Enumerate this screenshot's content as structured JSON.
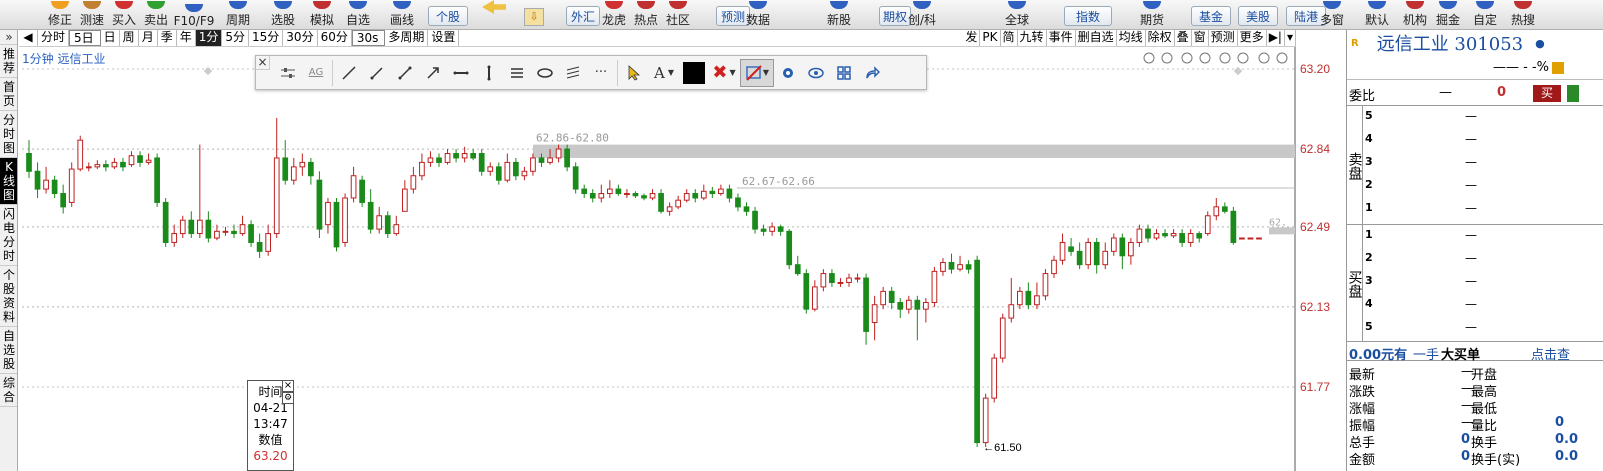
{
  "toolbar": {
    "items": [
      "修正",
      "测速",
      "买入",
      "卖出",
      "F10/F9",
      "周期",
      "选股",
      "模拟",
      "自选",
      "画线",
      "个股",
      "外汇",
      "龙虎",
      "热点",
      "社区",
      "预测",
      "数据",
      "新股",
      "期权",
      "创/科",
      "全球",
      "指数",
      "期货",
      "基金",
      "美股",
      "陆港",
      "多窗",
      "默认",
      "机构",
      "掘金",
      "自定",
      "热搜"
    ],
    "icon_colors": [
      "#f0a020",
      "#c08030",
      "#d03030",
      "#30a030",
      "#3060c0",
      "#3060c0",
      "#3060c0",
      "#c03030",
      "#3060c0",
      "#3060c0",
      "#e8b020",
      "#5080c0",
      "#d03030",
      "#c03030",
      "#c03030",
      "#3060c0",
      "#3060c0",
      "#3060c0",
      "#c03030",
      "#3060c0",
      "#3060c0",
      "#3060c0",
      "#3060c0",
      "#3060c0",
      "#3060c0",
      "#3060c0",
      "#3060c0",
      "#3060c0",
      "#c03030",
      "#3060c0",
      "#3060c0",
      "#c03030"
    ]
  },
  "leftnav": [
    "推荐",
    "首页",
    "分时图",
    "K线图",
    "闪电分时",
    "个股资料",
    "自选股",
    "综合"
  ],
  "periods": [
    "分时",
    "5日",
    "日",
    "周",
    "月",
    "季",
    "年",
    "1分",
    "5分",
    "15分",
    "30分",
    "60分"
  ],
  "period_select": "30s",
  "period_multi": "多周期",
  "period_settings": "设置",
  "active_period": "1分",
  "right_actions": [
    "发",
    "PK",
    "简",
    "九转",
    "事件",
    "删自选",
    "均线",
    "除权",
    "叠",
    "窗",
    "预测",
    "更多"
  ],
  "stock_label": "1分钟  远信工业",
  "y_ticks": [
    "63.20",
    "62.84",
    "62.49",
    "62.13",
    "61.77"
  ],
  "chart_data": {
    "type": "candlestick",
    "title": "1分钟 远信工业",
    "ylim": [
      61.45,
      63.25
    ],
    "y_ticks": [
      63.2,
      62.84,
      62.49,
      62.13,
      61.77
    ],
    "price_bands": [
      "62.86-62.80",
      "62.67-62.66"
    ],
    "low_marker": "61.50",
    "right_edge_label": "62.",
    "series": [
      {
        "o": 62.82,
        "c": 62.74,
        "h": 62.88,
        "l": 62.71
      },
      {
        "o": 62.74,
        "c": 62.66,
        "h": 62.78,
        "l": 62.62
      },
      {
        "o": 62.66,
        "c": 62.7,
        "h": 62.76,
        "l": 62.64
      },
      {
        "o": 62.7,
        "c": 62.64,
        "h": 62.72,
        "l": 62.62
      },
      {
        "o": 62.64,
        "c": 62.58,
        "h": 62.68,
        "l": 62.55
      },
      {
        "o": 62.6,
        "c": 62.75,
        "h": 62.78,
        "l": 62.58
      },
      {
        "o": 62.75,
        "c": 62.88,
        "h": 62.9,
        "l": 62.74
      },
      {
        "o": 62.76,
        "c": 62.76,
        "h": 62.78,
        "l": 62.74
      },
      {
        "o": 62.76,
        "c": 62.77,
        "h": 62.79,
        "l": 62.75
      },
      {
        "o": 62.77,
        "c": 62.76,
        "h": 62.79,
        "l": 62.74
      },
      {
        "o": 62.76,
        "c": 62.78,
        "h": 62.8,
        "l": 62.75
      },
      {
        "o": 62.78,
        "c": 62.76,
        "h": 62.8,
        "l": 62.74
      },
      {
        "o": 62.77,
        "c": 62.81,
        "h": 62.83,
        "l": 62.76
      },
      {
        "o": 62.81,
        "c": 62.78,
        "h": 62.83,
        "l": 62.76
      },
      {
        "o": 62.78,
        "c": 62.79,
        "h": 62.82,
        "l": 62.77
      },
      {
        "o": 62.8,
        "c": 62.6,
        "h": 62.82,
        "l": 62.58
      },
      {
        "o": 62.6,
        "c": 62.42,
        "h": 62.62,
        "l": 62.4
      },
      {
        "o": 62.42,
        "c": 62.46,
        "h": 62.5,
        "l": 62.4
      },
      {
        "o": 62.46,
        "c": 62.52,
        "h": 62.54,
        "l": 62.44
      },
      {
        "o": 62.52,
        "c": 62.46,
        "h": 62.56,
        "l": 62.44
      },
      {
        "o": 62.46,
        "c": 62.52,
        "h": 62.86,
        "l": 62.44
      },
      {
        "o": 62.52,
        "c": 62.44,
        "h": 62.56,
        "l": 62.42
      },
      {
        "o": 62.44,
        "c": 62.47,
        "h": 62.5,
        "l": 62.43
      },
      {
        "o": 62.47,
        "c": 62.47,
        "h": 62.49,
        "l": 62.45
      },
      {
        "o": 62.47,
        "c": 62.46,
        "h": 62.5,
        "l": 62.44
      },
      {
        "o": 62.46,
        "c": 62.5,
        "h": 62.54,
        "l": 62.45
      },
      {
        "o": 62.5,
        "c": 62.42,
        "h": 62.52,
        "l": 62.4
      },
      {
        "o": 62.42,
        "c": 62.38,
        "h": 62.46,
        "l": 62.35
      },
      {
        "o": 62.38,
        "c": 62.46,
        "h": 62.5,
        "l": 62.36
      },
      {
        "o": 62.46,
        "c": 62.8,
        "h": 62.98,
        "l": 62.44
      },
      {
        "o": 62.8,
        "c": 62.7,
        "h": 62.88,
        "l": 62.68
      },
      {
        "o": 62.7,
        "c": 62.76,
        "h": 62.8,
        "l": 62.68
      },
      {
        "o": 62.76,
        "c": 62.78,
        "h": 62.82,
        "l": 62.72
      },
      {
        "o": 62.78,
        "c": 62.72,
        "h": 62.8,
        "l": 62.68
      },
      {
        "o": 62.7,
        "c": 62.48,
        "h": 62.74,
        "l": 62.44
      },
      {
        "o": 62.5,
        "c": 62.6,
        "h": 62.62,
        "l": 62.46
      },
      {
        "o": 62.6,
        "c": 62.4,
        "h": 62.62,
        "l": 62.38
      },
      {
        "o": 62.42,
        "c": 62.62,
        "h": 62.64,
        "l": 62.4
      },
      {
        "o": 62.62,
        "c": 62.72,
        "h": 62.76,
        "l": 62.6
      },
      {
        "o": 62.7,
        "c": 62.6,
        "h": 62.72,
        "l": 62.58
      },
      {
        "o": 62.6,
        "c": 62.48,
        "h": 62.66,
        "l": 62.46
      },
      {
        "o": 62.48,
        "c": 62.54,
        "h": 62.58,
        "l": 62.46
      },
      {
        "o": 62.54,
        "c": 62.46,
        "h": 62.56,
        "l": 62.44
      },
      {
        "o": 62.46,
        "c": 62.5,
        "h": 62.54,
        "l": 62.45
      },
      {
        "o": 62.56,
        "c": 62.66,
        "h": 62.7,
        "l": 62.56
      },
      {
        "o": 62.66,
        "c": 62.72,
        "h": 62.76,
        "l": 62.64
      },
      {
        "o": 62.72,
        "c": 62.78,
        "h": 62.82,
        "l": 62.7
      },
      {
        "o": 62.78,
        "c": 62.8,
        "h": 62.83,
        "l": 62.76
      },
      {
        "o": 62.8,
        "c": 62.78,
        "h": 62.82,
        "l": 62.76
      },
      {
        "o": 62.78,
        "c": 62.82,
        "h": 62.84,
        "l": 62.77
      },
      {
        "o": 62.82,
        "c": 62.8,
        "h": 62.84,
        "l": 62.78
      },
      {
        "o": 62.8,
        "c": 62.82,
        "h": 62.85,
        "l": 62.78
      },
      {
        "o": 62.82,
        "c": 62.8,
        "h": 62.84,
        "l": 62.79
      },
      {
        "o": 62.82,
        "c": 62.74,
        "h": 62.84,
        "l": 62.72
      },
      {
        "o": 62.74,
        "c": 62.76,
        "h": 62.78,
        "l": 62.72
      },
      {
        "o": 62.76,
        "c": 62.7,
        "h": 62.78,
        "l": 62.68
      },
      {
        "o": 62.7,
        "c": 62.78,
        "h": 62.82,
        "l": 62.69
      },
      {
        "o": 62.78,
        "c": 62.72,
        "h": 62.8,
        "l": 62.7
      },
      {
        "o": 62.72,
        "c": 62.74,
        "h": 62.76,
        "l": 62.7
      },
      {
        "o": 62.74,
        "c": 62.8,
        "h": 62.82,
        "l": 62.72
      },
      {
        "o": 62.8,
        "c": 62.78,
        "h": 62.82,
        "l": 62.76
      },
      {
        "o": 62.78,
        "c": 62.8,
        "h": 62.84,
        "l": 62.77
      },
      {
        "o": 62.8,
        "c": 62.84,
        "h": 62.86,
        "l": 62.78
      },
      {
        "o": 62.84,
        "c": 62.76,
        "h": 62.86,
        "l": 62.74
      },
      {
        "o": 62.76,
        "c": 62.66,
        "h": 62.78,
        "l": 62.64
      },
      {
        "o": 62.66,
        "c": 62.64,
        "h": 62.68,
        "l": 62.62
      },
      {
        "o": 62.64,
        "c": 62.62,
        "h": 62.66,
        "l": 62.6
      },
      {
        "o": 62.62,
        "c": 62.64,
        "h": 62.68,
        "l": 62.6
      },
      {
        "o": 62.64,
        "c": 62.66,
        "h": 62.7,
        "l": 62.62
      },
      {
        "o": 62.66,
        "c": 62.64,
        "h": 62.68,
        "l": 62.63
      },
      {
        "o": 62.64,
        "c": 62.64,
        "h": 62.66,
        "l": 62.62
      },
      {
        "o": 62.64,
        "c": 62.63,
        "h": 62.65,
        "l": 62.62
      },
      {
        "o": 62.63,
        "c": 62.62,
        "h": 62.64,
        "l": 62.61
      },
      {
        "o": 62.62,
        "c": 62.64,
        "h": 62.66,
        "l": 62.61
      },
      {
        "o": 62.64,
        "c": 62.56,
        "h": 62.66,
        "l": 62.55
      },
      {
        "o": 62.56,
        "c": 62.58,
        "h": 62.6,
        "l": 62.54
      },
      {
        "o": 62.58,
        "c": 62.61,
        "h": 62.63,
        "l": 62.57
      },
      {
        "o": 62.61,
        "c": 62.64,
        "h": 62.66,
        "l": 62.6
      },
      {
        "o": 62.64,
        "c": 62.62,
        "h": 62.66,
        "l": 62.6
      },
      {
        "o": 62.62,
        "c": 62.65,
        "h": 62.68,
        "l": 62.61
      },
      {
        "o": 62.65,
        "c": 62.64,
        "h": 62.67,
        "l": 62.62
      },
      {
        "o": 62.64,
        "c": 62.66,
        "h": 62.68,
        "l": 62.63
      },
      {
        "o": 62.66,
        "c": 62.62,
        "h": 62.68,
        "l": 62.6
      },
      {
        "o": 62.62,
        "c": 62.58,
        "h": 62.64,
        "l": 62.56
      },
      {
        "o": 62.58,
        "c": 62.56,
        "h": 62.6,
        "l": 62.54
      },
      {
        "o": 62.56,
        "c": 62.48,
        "h": 62.58,
        "l": 62.46
      },
      {
        "o": 62.48,
        "c": 62.47,
        "h": 62.5,
        "l": 62.45
      },
      {
        "o": 62.47,
        "c": 62.49,
        "h": 62.51,
        "l": 62.45
      },
      {
        "o": 62.49,
        "c": 62.47,
        "h": 62.5,
        "l": 62.45
      },
      {
        "o": 62.47,
        "c": 62.32,
        "h": 62.48,
        "l": 62.3
      },
      {
        "o": 62.32,
        "c": 62.28,
        "h": 62.36,
        "l": 62.27
      },
      {
        "o": 62.28,
        "c": 62.12,
        "h": 62.3,
        "l": 62.1
      },
      {
        "o": 62.12,
        "c": 62.22,
        "h": 62.25,
        "l": 62.11
      },
      {
        "o": 62.22,
        "c": 62.28,
        "h": 62.3,
        "l": 62.2
      },
      {
        "o": 62.28,
        "c": 62.24,
        "h": 62.3,
        "l": 62.22
      },
      {
        "o": 62.24,
        "c": 62.24,
        "h": 62.26,
        "l": 62.22
      },
      {
        "o": 62.24,
        "c": 62.26,
        "h": 62.28,
        "l": 62.22
      },
      {
        "o": 62.26,
        "c": 62.26,
        "h": 62.28,
        "l": 62.24
      },
      {
        "o": 62.26,
        "c": 62.02,
        "h": 62.28,
        "l": 61.96
      },
      {
        "o": 62.06,
        "c": 62.14,
        "h": 62.18,
        "l": 61.98
      },
      {
        "o": 62.14,
        "c": 62.2,
        "h": 62.22,
        "l": 62.12
      },
      {
        "o": 62.2,
        "c": 62.15,
        "h": 62.22,
        "l": 62.12
      },
      {
        "o": 62.15,
        "c": 62.12,
        "h": 62.17,
        "l": 62.08
      },
      {
        "o": 62.12,
        "c": 62.16,
        "h": 62.18,
        "l": 62.1
      },
      {
        "o": 62.16,
        "c": 62.12,
        "h": 62.18,
        "l": 61.98
      },
      {
        "o": 62.12,
        "c": 62.15,
        "h": 62.17,
        "l": 62.06
      },
      {
        "o": 62.15,
        "c": 62.29,
        "h": 62.31,
        "l": 62.13
      },
      {
        "o": 62.29,
        "c": 62.33,
        "h": 62.35,
        "l": 62.27
      },
      {
        "o": 62.33,
        "c": 62.3,
        "h": 62.37,
        "l": 62.28
      },
      {
        "o": 62.3,
        "c": 62.32,
        "h": 62.36,
        "l": 62.29
      },
      {
        "o": 62.32,
        "c": 62.3,
        "h": 62.34,
        "l": 62.28
      },
      {
        "o": 62.34,
        "c": 61.52,
        "h": 62.36,
        "l": 61.5
      },
      {
        "o": 61.52,
        "c": 61.72,
        "h": 61.74,
        "l": 61.5
      },
      {
        "o": 61.72,
        "c": 61.9,
        "h": 61.92,
        "l": 61.7
      },
      {
        "o": 61.9,
        "c": 62.08,
        "h": 62.1,
        "l": 61.88
      },
      {
        "o": 62.08,
        "c": 62.14,
        "h": 62.26,
        "l": 62.06
      },
      {
        "o": 62.14,
        "c": 62.2,
        "h": 62.22,
        "l": 62.12
      },
      {
        "o": 62.2,
        "c": 62.14,
        "h": 62.24,
        "l": 62.12
      },
      {
        "o": 62.14,
        "c": 62.18,
        "h": 62.24,
        "l": 62.12
      },
      {
        "o": 62.18,
        "c": 62.28,
        "h": 62.3,
        "l": 62.16
      },
      {
        "o": 62.28,
        "c": 62.34,
        "h": 62.36,
        "l": 62.26
      },
      {
        "o": 62.34,
        "c": 62.42,
        "h": 62.46,
        "l": 62.32
      },
      {
        "o": 62.4,
        "c": 62.38,
        "h": 62.44,
        "l": 62.36
      },
      {
        "o": 62.38,
        "c": 62.32,
        "h": 62.42,
        "l": 62.3
      },
      {
        "o": 62.32,
        "c": 62.42,
        "h": 62.44,
        "l": 62.3
      },
      {
        "o": 62.42,
        "c": 62.32,
        "h": 62.44,
        "l": 62.28
      },
      {
        "o": 62.32,
        "c": 62.38,
        "h": 62.42,
        "l": 62.3
      },
      {
        "o": 62.38,
        "c": 62.44,
        "h": 62.46,
        "l": 62.36
      },
      {
        "o": 62.44,
        "c": 62.36,
        "h": 62.46,
        "l": 62.3
      },
      {
        "o": 62.36,
        "c": 62.42,
        "h": 62.44,
        "l": 62.32
      },
      {
        "o": 62.42,
        "c": 62.48,
        "h": 62.5,
        "l": 62.4
      },
      {
        "o": 62.48,
        "c": 62.44,
        "h": 62.5,
        "l": 62.42
      },
      {
        "o": 62.44,
        "c": 62.46,
        "h": 62.48,
        "l": 62.43
      },
      {
        "o": 62.46,
        "c": 62.45,
        "h": 62.48,
        "l": 62.44
      },
      {
        "o": 62.45,
        "c": 62.46,
        "h": 62.48,
        "l": 62.44
      },
      {
        "o": 62.46,
        "c": 62.42,
        "h": 62.48,
        "l": 62.4
      },
      {
        "o": 62.42,
        "c": 62.46,
        "h": 62.48,
        "l": 62.4
      },
      {
        "o": 62.46,
        "c": 62.44,
        "h": 62.47,
        "l": 62.42
      },
      {
        "o": 62.46,
        "c": 62.54,
        "h": 62.56,
        "l": 62.45
      },
      {
        "o": 62.54,
        "c": 62.58,
        "h": 62.62,
        "l": 62.52
      },
      {
        "o": 62.58,
        "c": 62.56,
        "h": 62.6,
        "l": 62.55
      },
      {
        "o": 62.56,
        "c": 62.42,
        "h": 62.58,
        "l": 62.41
      },
      {
        "o": 62.44,
        "c": 62.44,
        "h": 62.44,
        "l": 62.44
      },
      {
        "o": 62.44,
        "c": 62.44,
        "h": 62.44,
        "l": 62.44
      },
      {
        "o": 62.44,
        "c": 62.44,
        "h": 62.44,
        "l": 62.44
      }
    ]
  },
  "tooltip": {
    "title": "时间",
    "date": "04-21",
    "time": "13:47",
    "label": "数值",
    "value": "63.20"
  },
  "quote": {
    "name_code": "远信工业 301053",
    "change_text": "——  -  -%",
    "weibi_label": "委比",
    "weibi_value": "—",
    "weibi_num": "0",
    "buy_btn": "买",
    "sell_side": "卖盘",
    "buy_side": "买盘",
    "sell_levels": [
      "5",
      "4",
      "3",
      "2",
      "1"
    ],
    "buy_levels": [
      "1",
      "2",
      "3",
      "4",
      "5"
    ],
    "dash": "—",
    "bigorder": "0.00元有",
    "bigorder_hand": "一手",
    "bigorder_label": "大买单",
    "bigorder_link": "点击查",
    "stats_left": [
      "最新",
      "涨跌",
      "涨幅",
      "振幅",
      "总手",
      "金额"
    ],
    "stats_mid": [
      "开盘",
      "最高",
      "最低",
      "量比",
      "换手",
      "换手(实)"
    ],
    "stats_left_vals": [
      "—",
      "—",
      "—",
      "—",
      "0",
      "0"
    ],
    "stats_right_vals": [
      "",
      "",
      "",
      "0",
      "0.0",
      "0.0"
    ]
  }
}
